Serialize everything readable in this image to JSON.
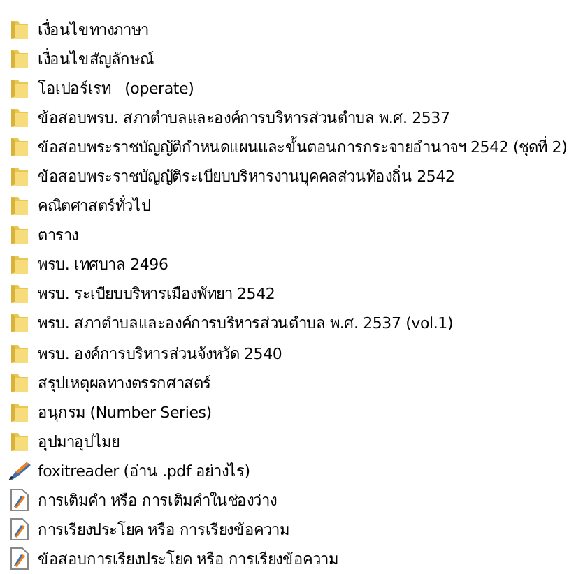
{
  "files": [
    {
      "kind": "folder",
      "name": "เงื่อนไขทางภาษา"
    },
    {
      "kind": "folder",
      "name": "เงื่อนไขสัญลักษณ์"
    },
    {
      "kind": "folder",
      "name": "โอเปอร์เรท   (operate)"
    },
    {
      "kind": "folder",
      "name": "ข้อสอบพรบ. สภาตำบลและองค์การบริหารส่วนตำบล พ.ศ. 2537"
    },
    {
      "kind": "folder",
      "name": "ข้อสอบพระราชบัญญัติกำหนดแผนและขั้นตอนการกระจายอำนาจฯ 2542 (ชุดที่ 2)"
    },
    {
      "kind": "folder",
      "name": "ข้อสอบพระราชบัญญัติระเบียบบริหารงานบุคคลส่วนท้องถิ่น 2542"
    },
    {
      "kind": "folder",
      "name": "คณิตศาสตร์ทั่วไป"
    },
    {
      "kind": "folder",
      "name": "ตาราง"
    },
    {
      "kind": "folder",
      "name": "พรบ. เทศบาล 2496"
    },
    {
      "kind": "folder",
      "name": "พรบ. ระเบียบบริหารเมืองพัทยา 2542"
    },
    {
      "kind": "folder",
      "name": "พรบ. สภาตำบลและองค์การบริหารส่วนตำบล พ.ศ. 2537 (vol.1)"
    },
    {
      "kind": "folder",
      "name": "พรบ. องค์การบริหารส่วนจังหวัด 2540"
    },
    {
      "kind": "folder",
      "name": "สรุปเหตุผลทางตรรกศาสตร์"
    },
    {
      "kind": "folder",
      "name": "อนุกรม (Number Series)"
    },
    {
      "kind": "folder",
      "name": "อุปมาอุปไมย"
    },
    {
      "kind": "app",
      "name": "foxitreader (อ่าน .pdf อย่างไร)"
    },
    {
      "kind": "pdf",
      "name": "การเติมคำ หรือ การเติมคำในช่องว่าง"
    },
    {
      "kind": "pdf",
      "name": "การเรียงประโยค หรือ การเรียงข้อความ"
    },
    {
      "kind": "pdf",
      "name": "ข้อสอบการเรียงประโยค หรือ การเรียงข้อความ"
    }
  ]
}
